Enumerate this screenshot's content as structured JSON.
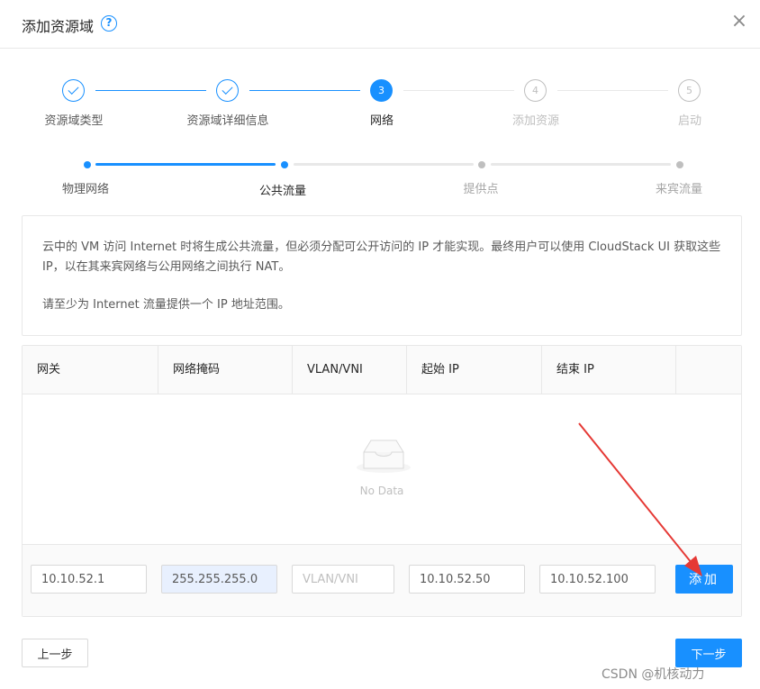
{
  "dialog": {
    "title": "添加资源域",
    "help_icon": "question-circle-icon",
    "close_icon": "close-icon",
    "close_glyph": "×"
  },
  "steps": [
    {
      "label": "资源域类型",
      "state": "finished",
      "number": ""
    },
    {
      "label": "资源域详细信息",
      "state": "finished",
      "number": ""
    },
    {
      "label": "网络",
      "state": "active",
      "number": "3"
    },
    {
      "label": "添加资源",
      "state": "waiting",
      "number": "4"
    },
    {
      "label": "启动",
      "state": "waiting",
      "number": "5"
    }
  ],
  "substeps": [
    {
      "label": "物理网络",
      "state": "finished"
    },
    {
      "label": "公共流量",
      "state": "active"
    },
    {
      "label": "提供点",
      "state": "waiting"
    },
    {
      "label": "来宾流量",
      "state": "waiting"
    }
  ],
  "info": {
    "paragraph1": "云中的 VM 访问 Internet 时将生成公共流量，但必须分配可公开访问的 IP 才能实现。最终用户可以使用 CloudStack UI 获取这些 IP，以在其来宾网络与公用网络之间执行 NAT。",
    "paragraph2": "请至少为 Internet 流量提供一个 IP 地址范围。"
  },
  "table": {
    "columns": [
      "网关",
      "网络掩码",
      "VLAN/VNI",
      "起始 IP",
      "结束 IP"
    ],
    "empty_text": "No Data"
  },
  "form": {
    "gateway_value": "10.10.52.1",
    "netmask_value": "255.255.255.0",
    "vlan_placeholder": "VLAN/VNI",
    "start_ip_value": "10.10.52.50",
    "end_ip_value": "10.10.52.100",
    "add_label": "添加"
  },
  "footer": {
    "prev_label": "上一步",
    "next_label": "下一步"
  },
  "watermark": "CSDN @机核动力",
  "colors": {
    "primary": "#1890ff",
    "annotation_arrow": "#e53935"
  }
}
